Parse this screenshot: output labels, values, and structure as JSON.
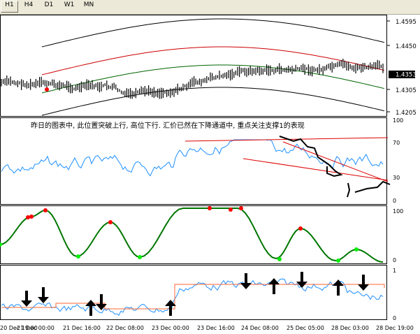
{
  "toolbar": {
    "timeframes": [
      "H1",
      "H4",
      "D1",
      "W1",
      "MN"
    ]
  },
  "main_chart": {
    "price_labels": [
      "1.4595",
      "1.4450",
      "1.4353",
      "1.4305",
      "1.4205"
    ],
    "current_price": "1.4353"
  },
  "annotation": {
    "text": "昨日的图表中, 此位置突破上行, 高位下行. 汇价已然在下降通道中, 重点关注支撑1的表现"
  },
  "panel2": {
    "levels": [
      "100",
      "70",
      "30",
      "0"
    ]
  },
  "panel3": {
    "levels": [
      "100",
      "0"
    ]
  },
  "panel4": {
    "levels": [
      "1",
      "0"
    ]
  },
  "time_axis": {
    "labels": [
      "20 Dec 19:00",
      "21 Dec 00:00",
      "21 Dec 16:00",
      "22 Dec 08:00",
      "23 Dec 00:00",
      "23 Dec 16:00",
      "24 Dec 08:00",
      "25 Dec 05:00",
      "28 Dec 03:00",
      "28 Dec 19:00"
    ]
  },
  "signals": [
    "down",
    "down",
    "up",
    "down",
    "up",
    "down",
    "up",
    "down",
    "up",
    "down"
  ],
  "colors": {
    "price_bars": "#000000",
    "envelope_outer": "#000000",
    "envelope_mid": "#cc0000",
    "envelope_inner": "#006600",
    "rsi_line": "#1e90ff",
    "trend_lines": "#dd0000",
    "oscillator": "#007700",
    "dot_high": "#ff0000",
    "dot_low": "#00ee00",
    "step_blue": "#1e90ff",
    "step_orange": "#ff6633"
  }
}
